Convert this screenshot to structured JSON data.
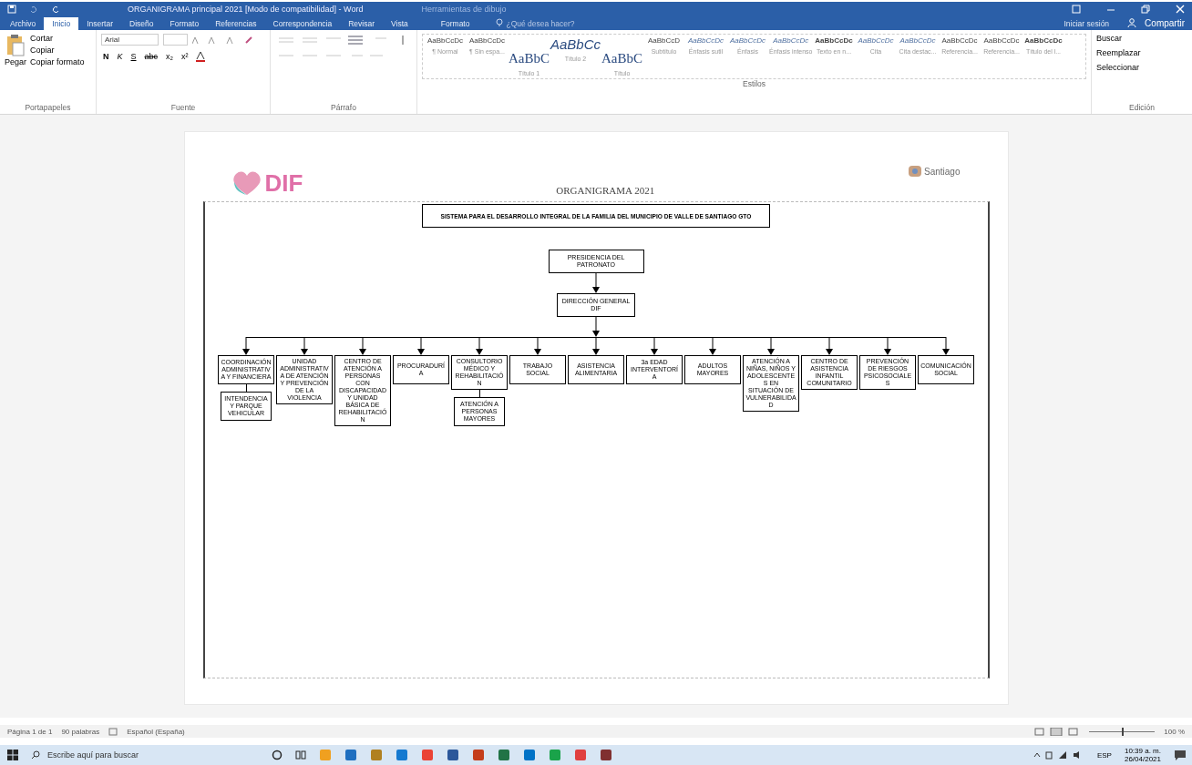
{
  "window": {
    "title": "ORGANIGRAMA principal 2021 [Modo de compatibilidad] - Word",
    "context_label": "Herramientas de dibujo"
  },
  "tabs": [
    {
      "label": "Archivo",
      "selected": false
    },
    {
      "label": "Inicio",
      "selected": true
    },
    {
      "label": "Insertar",
      "selected": false
    },
    {
      "label": "Diseño",
      "selected": false
    },
    {
      "label": "Formato",
      "selected": false
    },
    {
      "label": "Referencias",
      "selected": false
    },
    {
      "label": "Correspondencia",
      "selected": false
    },
    {
      "label": "Revisar",
      "selected": false
    },
    {
      "label": "Vista",
      "selected": false
    },
    {
      "label": "Formato",
      "selected": false
    }
  ],
  "tell_me": "¿Qué desea hacer?",
  "sign_in": "Iniciar sesión",
  "share": "Compartir",
  "clipboard": {
    "paste": "Pegar",
    "items": [
      "Cortar",
      "Copiar",
      "Copiar formato"
    ],
    "label": "Portapapeles"
  },
  "font": {
    "name": "Arial",
    "buttons": [
      {
        "text": "N",
        "kind": "bold"
      },
      {
        "text": "K",
        "kind": "italic"
      },
      {
        "text": "S",
        "kind": "underline"
      },
      {
        "text": "abc",
        "kind": "strike"
      },
      {
        "text": "x₂",
        "kind": "plain"
      },
      {
        "text": "x²",
        "kind": "plain"
      }
    ],
    "label": "Fuente"
  },
  "paragraph": {
    "label": "Párrafo"
  },
  "styles": {
    "label": "Estilos",
    "items": [
      {
        "sample": "AaBbCcDc",
        "name": "¶ Normal",
        "kind": "text"
      },
      {
        "sample": "AaBbCcDc",
        "name": "¶ Sin espa...",
        "kind": "text"
      },
      {
        "sample": "AaBbC",
        "name": "Título 1",
        "kind": "heading"
      },
      {
        "sample": "AaBbCc",
        "name": "Título 2",
        "kind": "heading-italic"
      },
      {
        "sample": "AaBbC",
        "name": "Título",
        "kind": "heading"
      },
      {
        "sample": "AaBbCcD",
        "name": "Subtítulo",
        "kind": "text"
      },
      {
        "sample": "AaBbCcDc",
        "name": "Énfasis sutil",
        "kind": "text-italic"
      },
      {
        "sample": "AaBbCcDc",
        "name": "Énfasis",
        "kind": "text-italic"
      },
      {
        "sample": "AaBbCcDc",
        "name": "Énfasis intenso",
        "kind": "text-italic"
      },
      {
        "sample": "AaBbCcDc",
        "name": "Texto en n...",
        "kind": "text-bold"
      },
      {
        "sample": "AaBbCcDc",
        "name": "Cita",
        "kind": "text-italic"
      },
      {
        "sample": "AaBbCcDc",
        "name": "Cita destac...",
        "kind": "text-italic"
      },
      {
        "sample": "AaBbCcDc",
        "name": "Referencia...",
        "kind": "text"
      },
      {
        "sample": "AaBbCcDc",
        "name": "Referencia...",
        "kind": "text"
      },
      {
        "sample": "AaBbCcDc",
        "name": "Título del l...",
        "kind": "text-bold"
      }
    ]
  },
  "editing": {
    "items": [
      "Buscar",
      "Reemplazar",
      "Seleccionar"
    ],
    "label": "Edición"
  },
  "document": {
    "logo": "DIF",
    "logo_right": "Santiago",
    "heading": "ORGANIGRAMA 2021",
    "chart": {
      "title": "SISTEMA PARA EL DESARROLLO INTEGRAL DE LA FAMILIA DEL MUNICIPIO DE VALLE DE SANTIAGO GTO",
      "top": "PRESIDENCIA DEL PATRONATO",
      "director": "DIRECCIÓN GENERAL DIF",
      "units": [
        {
          "label": "COORDINACIÓN ADMINISTRATIVA Y FINANCIERA",
          "children": [
            {
              "label": "INTENDENCIA Y PARQUE VEHICULAR"
            }
          ]
        },
        {
          "label": "UNIDAD ADMINISTRATIVA DE ATENCIÓN Y PREVENCIÓN DE LA VIOLENCIA"
        },
        {
          "label": "CENTRO DE ATENCIÓN A PERSONAS CON DISCAPACIDAD Y UNIDAD BÁSICA DE REHABILITACIÓN"
        },
        {
          "label": "PROCURADURÍA"
        },
        {
          "label": "CONSULTORIO MÉDICO Y REHABILITACIÓN",
          "children": [
            {
              "label": "ATENCIÓN A PERSONAS MAYORES"
            }
          ]
        },
        {
          "label": "TRABAJO SOCIAL"
        },
        {
          "label": "ASISTENCIA ALIMENTARIA"
        },
        {
          "label": "3a EDAD INTERVENTORÍA"
        },
        {
          "label": "ADULTOS MAYORES"
        },
        {
          "label": "ATENCIÓN A NIÑAS, NIÑOS Y ADOLESCENTES EN SITUACIÓN DE VULNERABILIDAD"
        },
        {
          "label": "CENTRO DE ASISTENCIA INFANTIL COMUNITARIO"
        },
        {
          "label": "PREVENCIÓN DE RIESGOS PSICOSOCIALES"
        },
        {
          "label": "COMUNICACIÓN SOCIAL"
        }
      ]
    }
  },
  "status_bar": {
    "page": "Página 1 de 1",
    "words": "90 palabras",
    "language": "Español (España)",
    "zoom_slider": {
      "level": 0.5
    },
    "zoom": "100 %"
  },
  "taskbar": {
    "search_placeholder": "Escribe aquí para buscar",
    "language": "ESP",
    "time": "10:39 a. m.",
    "date": "26/04/2021"
  }
}
